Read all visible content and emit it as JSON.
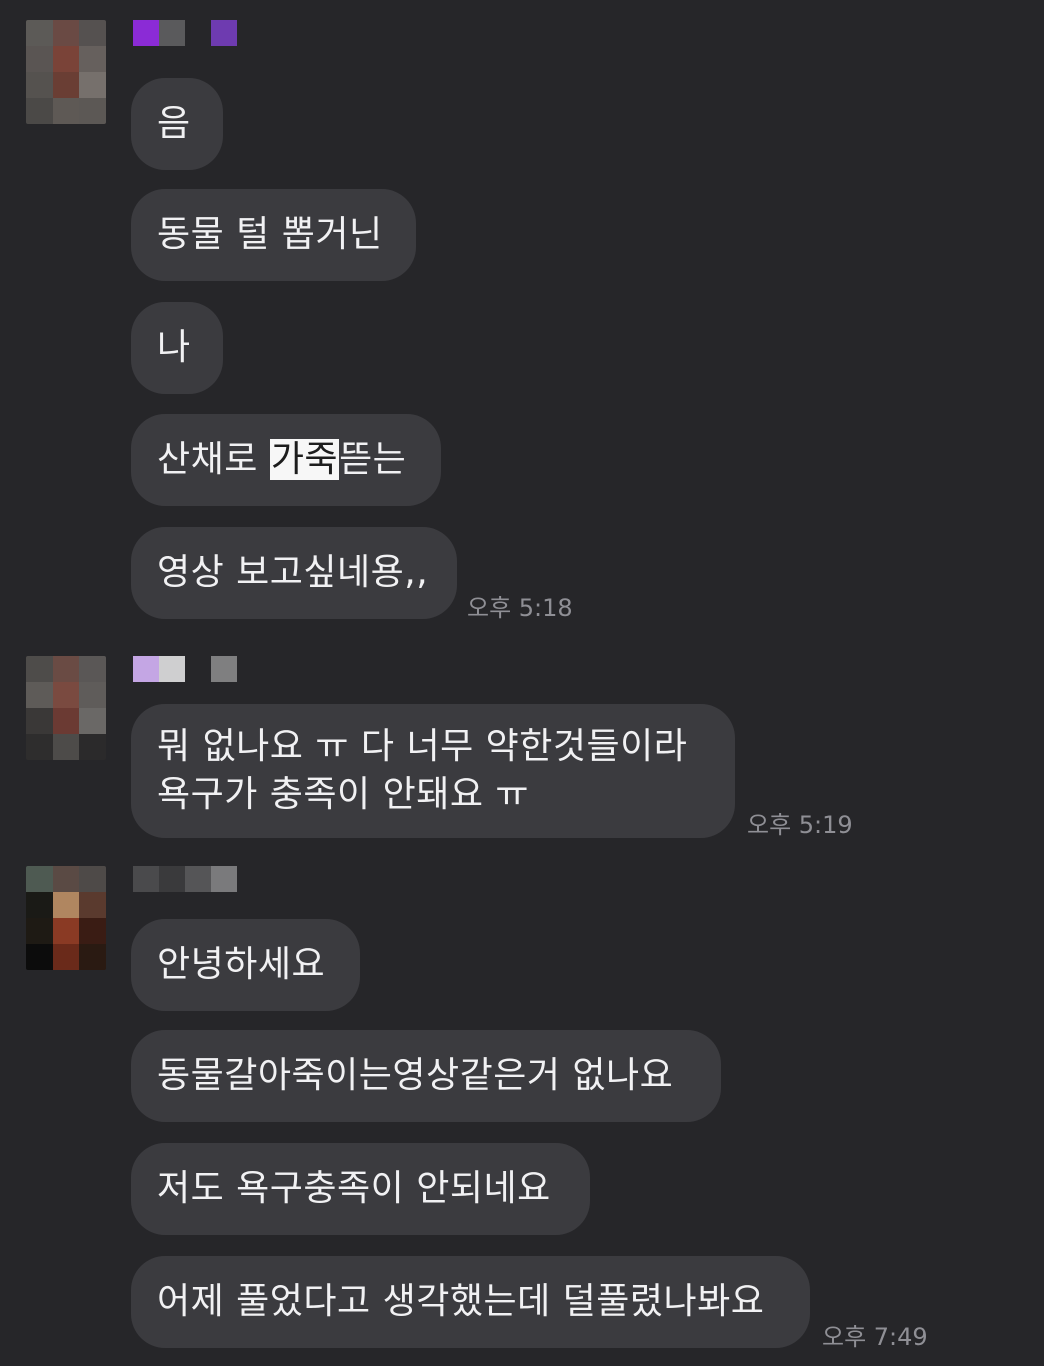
{
  "threads": [
    {
      "avatar_colors": [
        "#5c5a57",
        "#6a4a44",
        "#555150",
        "#5a5553",
        "#7a4338",
        "#66605d",
        "#55524f",
        "#6a3e34",
        "#76706c",
        "#4b4947",
        "#5e5955",
        "#5c5855"
      ],
      "name_colors": [
        "#8b2bd6",
        "#5a5a5c",
        "#262629",
        "#6e3bb0",
        "#262629",
        "#262629"
      ],
      "messages": [
        {
          "text": "음"
        },
        {
          "text": "동물 털 뽑거닌"
        },
        {
          "text": "나"
        },
        {
          "before": "산채로 ",
          "highlight": "가죽",
          "after": "뜯는"
        },
        {
          "text": "영상 보고싶네용,,"
        }
      ],
      "time": "오후 5:18"
    },
    {
      "avatar_colors": [
        "#4e4c4a",
        "#6a4b44",
        "#5a5756",
        "#5e5b58",
        "#7a4a40",
        "#5f5c5a",
        "#3a3837",
        "#6b3a33",
        "#6a6866",
        "#2e2d2d",
        "#4d4b49",
        "#2b2a2b"
      ],
      "name_colors": [
        "#c4a6e4",
        "#cfcfd0",
        "#262629",
        "#7f7f80"
      ],
      "messages": [
        {
          "lines": [
            "뭐 없나요 ㅠ 다 너무 약한것들이라",
            "욕구가 충족이 안돼요 ㅠ"
          ]
        }
      ],
      "time": "오후 5:19"
    },
    {
      "avatar_colors": [
        "#4e5a52",
        "#5a4a44",
        "#4e4a48",
        "#1a1a16",
        "#b08660",
        "#5a3a2e",
        "#1e1a14",
        "#8a3a24",
        "#3a1c14",
        "#0c0c0c",
        "#6a2a1a",
        "#2a1a12"
      ],
      "name_colors": [
        "#4a4a4c",
        "#3a3a3c",
        "#555557",
        "#7a7a7c"
      ],
      "messages": [
        {
          "text": "안녕하세요"
        },
        {
          "text": "동물갈아죽이는영상같은거 없나요"
        },
        {
          "text": "저도 욕구충족이 안되네요"
        },
        {
          "text": "어제 풀었다고 생각했는데 덜풀렸나봐요"
        }
      ],
      "time": "오후 7:49"
    }
  ]
}
